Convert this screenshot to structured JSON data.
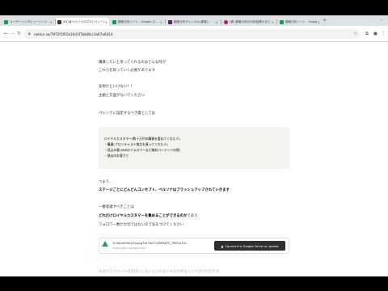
{
  "browser": {
    "tabs": [
      {
        "title": "ユーザーインタビューシート - ...",
        "favicon_color": "#0f9d58"
      },
      {
        "title": "初心者ペルソナのLTVとパレート...",
        "favicon_color": "#37352f"
      },
      {
        "title": "顧客分析シート - Google ス...",
        "favicon_color": "#0f9d58"
      },
      {
        "title": "顧客分析チャンネル(顧客)...",
        "favicon_color": "#611f69"
      },
      {
        "title": "(株) 顧客分析の分析結果のまとめ",
        "favicon_color": "#c2185b"
      },
      {
        "title": "顧客分析シート - Google ス...",
        "favicon_color": "#0f9d58"
      }
    ],
    "new_tab_glyph": "+",
    "close_glyph": "×",
    "url": "notion.so/7972f1f01b10d1f7bb8fcc3a67a6414",
    "icons": {
      "back": "back-arrow-icon",
      "forward": "forward-arrow-icon",
      "reload": "reload-icon",
      "lock": "lock-icon",
      "star": "star-icon"
    }
  },
  "content": {
    "p1": "購買したいと思ってくれるのはどんな時が",
    "p2": "これらを知っていく必要があります",
    "p3": "妄想だといけない！！",
    "p4": "主観と方面がないでください",
    "p5": "ペルソナに設定するべき層としては",
    "callout": [
      "ロイヤルカスタマー(数十万円の購買を重ねてくれた人)",
      "・購買(プロンキャスト商品を買ってくれた人)",
      "・見込み客(SNSのフォロワーなど無料コンテンツの層)",
      "・過去のお客さと"
    ],
    "p6": "つまり...",
    "p7": "ステージごとにどんどんコンセプト、ペルソナはブラッシュアップされていきます",
    "p8": "一番意識すべきことは",
    "p9_bold": "どれだけロイヤルカスタマーを集めることができるのか",
    "p9_rest": "であり",
    "p10": "フォロワー数が大切ではないので気をつけてください",
    "bookmark_title": "1F4dvnS35LVYyypg7ol-9w7CZSP6KTC_PKOQrUe...",
    "bookmark_host": "https://docs.google.com",
    "connect_label": "Connect to Google Drive to update",
    "tail": "そのた三つパートの大切にしないといけないものがあるというのが大切です"
  }
}
